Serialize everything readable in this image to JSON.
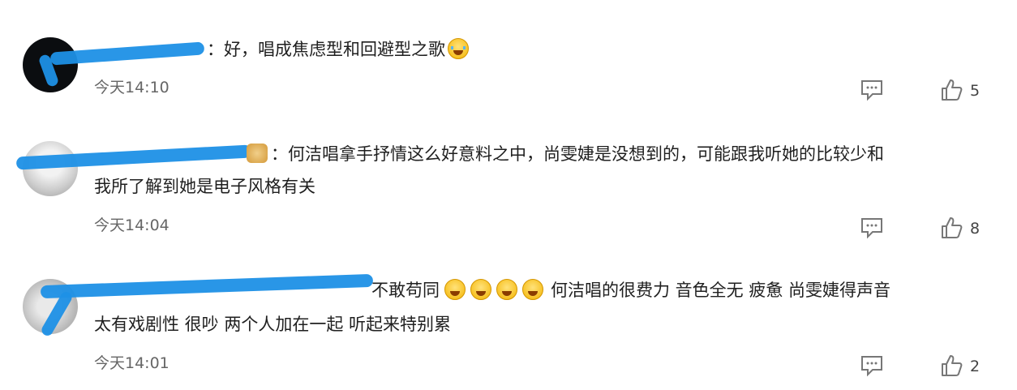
{
  "comments": [
    {
      "text_line1": "：好，唱成焦虑型和回避型之歌",
      "text_line2": "",
      "time": "今天14:10",
      "likes": "5",
      "emoji": "crying-face"
    },
    {
      "text_line1": "：何洁唱拿手抒情这么好意料之中，尚雯婕是没想到的，可能跟我听她的比较少和",
      "text_line2": "我所了解到她是电子风格有关",
      "time": "今天14:04",
      "likes": "8",
      "emoji": "badge-icon"
    },
    {
      "text_line1_a": "不敢苟同",
      "text_line1_b": "何洁唱的很费力 音色全无 疲惫 尚雯婕得声音",
      "text_line2": "太有戏剧性 很吵 两个人加在一起 听起来特别累",
      "time": "今天14:01",
      "likes": "2",
      "emoji": "laughing-face"
    }
  ],
  "colors": {
    "scribble": "#1d90e6",
    "icon": "#777777"
  }
}
